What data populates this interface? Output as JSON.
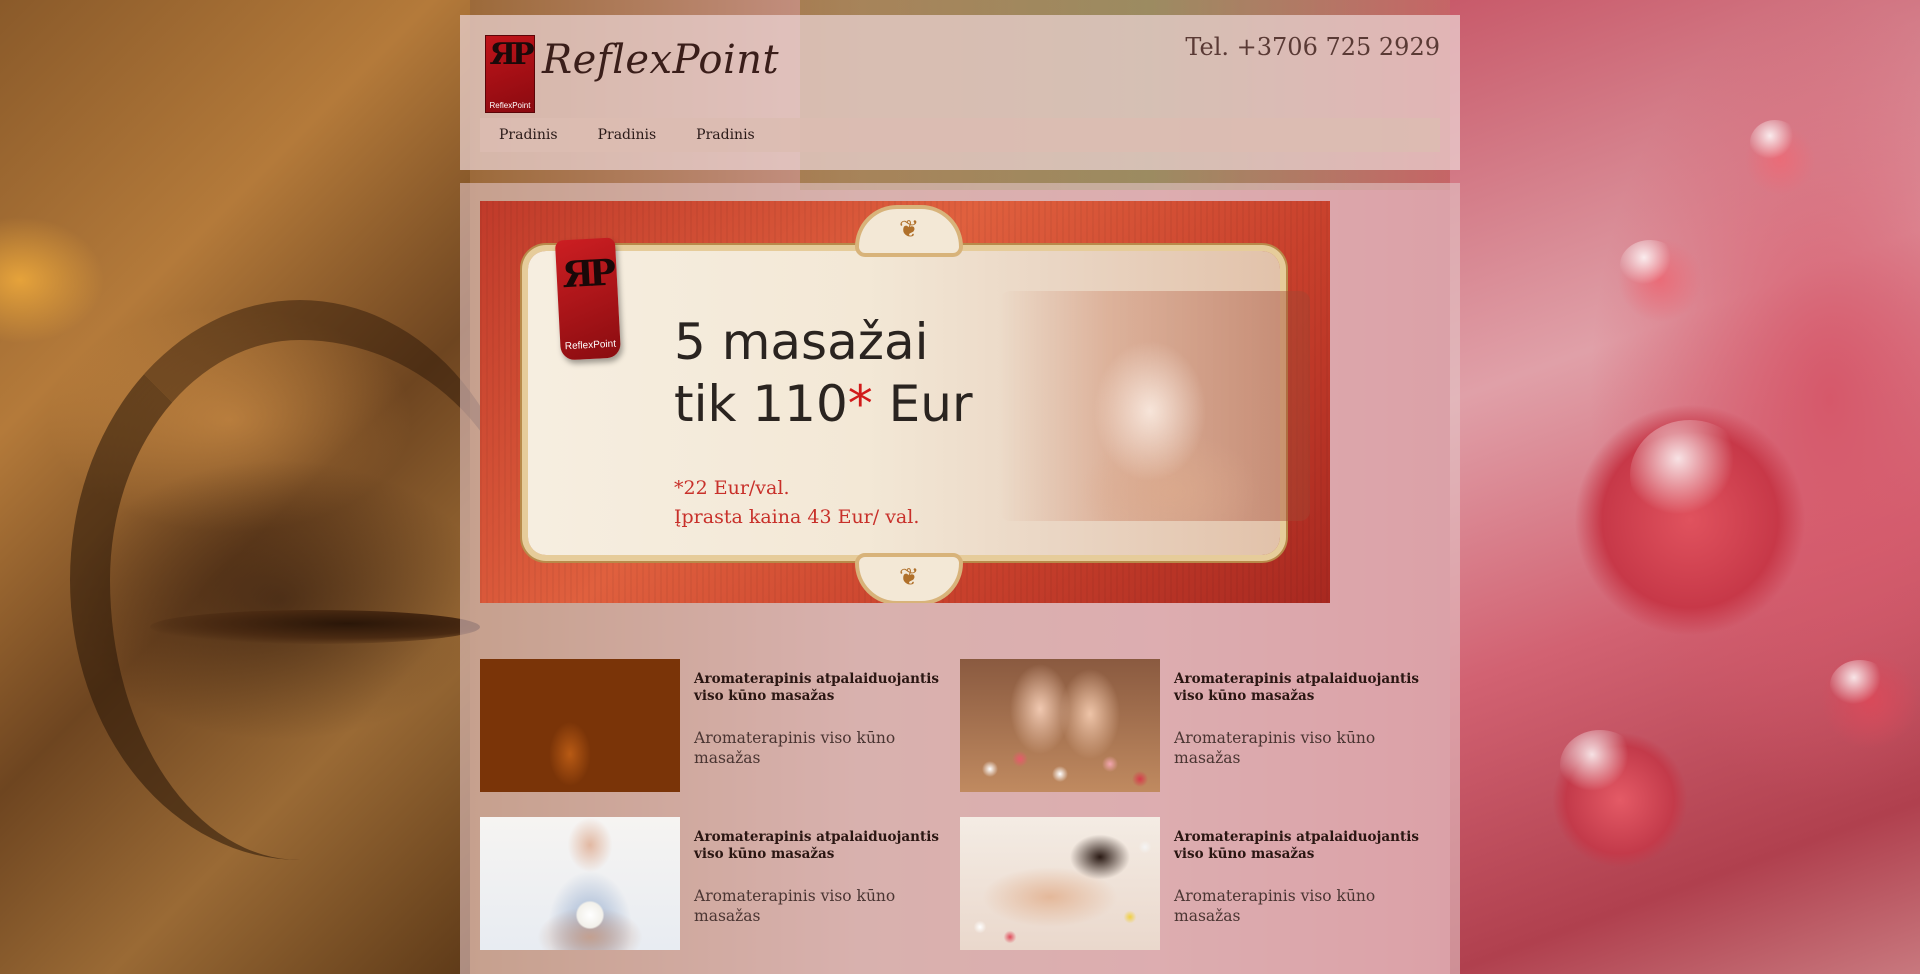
{
  "header": {
    "logo_mini_text": "ReflexPoint",
    "brand": "ReflexPoint",
    "phone": "Tel. +3706 725 2929"
  },
  "nav": {
    "items": [
      {
        "label": "Pradinis"
      },
      {
        "label": "Pradinis"
      },
      {
        "label": "Pradinis"
      }
    ]
  },
  "banner": {
    "badge_text": "ReflexPoint",
    "headline_line1": "5 masažai",
    "headline_line2_prefix": "tik 110",
    "headline_star": "*",
    "headline_line2_suffix": " Eur",
    "note_line1": "*22 Eur/val.",
    "note_line2": "Įprasta kaina 43 Eur/ val."
  },
  "services": [
    {
      "title": "Aromaterapinis atpalaiduojantis viso kūno masažas",
      "description": "Aromaterapinis viso kūno masažas",
      "image": "oil-bottles"
    },
    {
      "title": "Aromaterapinis atpalaiduojantis viso kūno masažas",
      "description": "Aromaterapinis viso kūno masažas",
      "image": "feet-petals"
    },
    {
      "title": "Aromaterapinis atpalaiduojantis viso kūno masažas",
      "description": "Aromaterapinis viso kūno masažas",
      "image": "woman-flower"
    },
    {
      "title": "Aromaterapinis atpalaiduojantis viso kūno masažas",
      "description": "Aromaterapinis viso kūno masažas",
      "image": "back-massage"
    }
  ]
}
